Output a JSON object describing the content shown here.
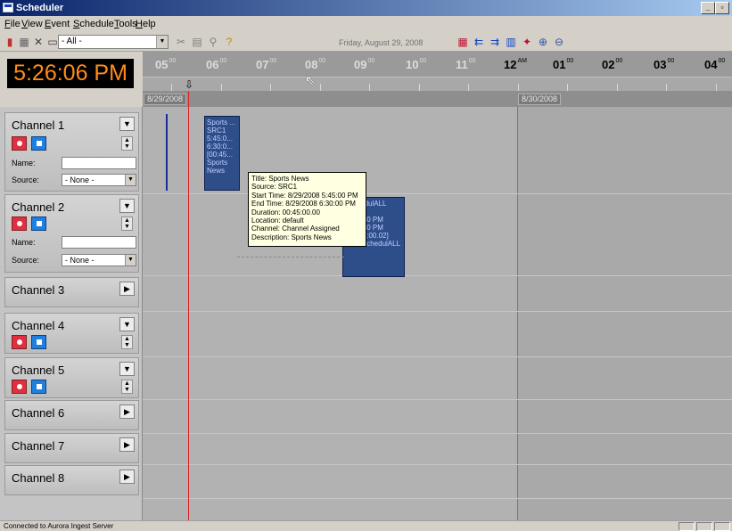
{
  "window": {
    "title": "Scheduler"
  },
  "menu": [
    "File",
    "View",
    "Event",
    "Schedule",
    "Tools",
    "Help"
  ],
  "toolbar": {
    "filter_value": "- All -",
    "date_text": "Friday, August 29, 2008"
  },
  "clock": {
    "time": "5:26:06 PM"
  },
  "timeline": {
    "hours": [
      {
        "h": "05",
        "m": "00"
      },
      {
        "h": "06",
        "m": "00"
      },
      {
        "h": "07",
        "m": "00"
      },
      {
        "h": "08",
        "m": "00"
      },
      {
        "h": "09",
        "m": "00"
      },
      {
        "h": "10",
        "m": "00"
      },
      {
        "h": "11",
        "m": "00"
      },
      {
        "h": "12",
        "m": "AM"
      },
      {
        "h": "01",
        "m": "00"
      },
      {
        "h": "02",
        "m": "00"
      },
      {
        "h": "03",
        "m": "00"
      },
      {
        "h": "04",
        "m": "00"
      }
    ],
    "dates": [
      "8/29/2008",
      "8/30/2008"
    ]
  },
  "channels": [
    {
      "name": "Channel 1",
      "expanded": true,
      "name_label": "Name:",
      "source_label": "Source:",
      "source_value": "- None -"
    },
    {
      "name": "Channel 2",
      "expanded": true,
      "name_label": "Name:",
      "source_label": "Source:",
      "source_value": "- None -"
    },
    {
      "name": "Channel 3",
      "expanded": false
    },
    {
      "name": "Channel 4",
      "expanded": true
    },
    {
      "name": "Channel 5",
      "expanded": true
    },
    {
      "name": "Channel 6",
      "expanded": false
    },
    {
      "name": "Channel 7",
      "expanded": false
    },
    {
      "name": "Channel 8",
      "expanded": false
    }
  ],
  "event1": {
    "lines": [
      "Sports ...",
      "SRC1",
      "5:45:0...",
      "6:30:0...",
      "[00:45...",
      "Sports",
      "News"
    ]
  },
  "event2": {
    "lines": [
      "...chedulALL",
      "SRC1",
      "6:30:00 PM",
      "7:45:00 PM",
      "[01:15:00.02]",
      "from schedulALL"
    ]
  },
  "tooltip": {
    "lines": [
      "Title: Sports News",
      "Source: SRC1",
      "Start Time: 8/29/2008 5:45:00 PM",
      "End Time: 8/29/2008 6:30:00 PM",
      "Duration: 00:45:00.00",
      "Location: default",
      "Channel: Channel Assigned",
      "Description: Sports News"
    ]
  },
  "status": {
    "text": "Connected to Aurora Ingest Server"
  }
}
